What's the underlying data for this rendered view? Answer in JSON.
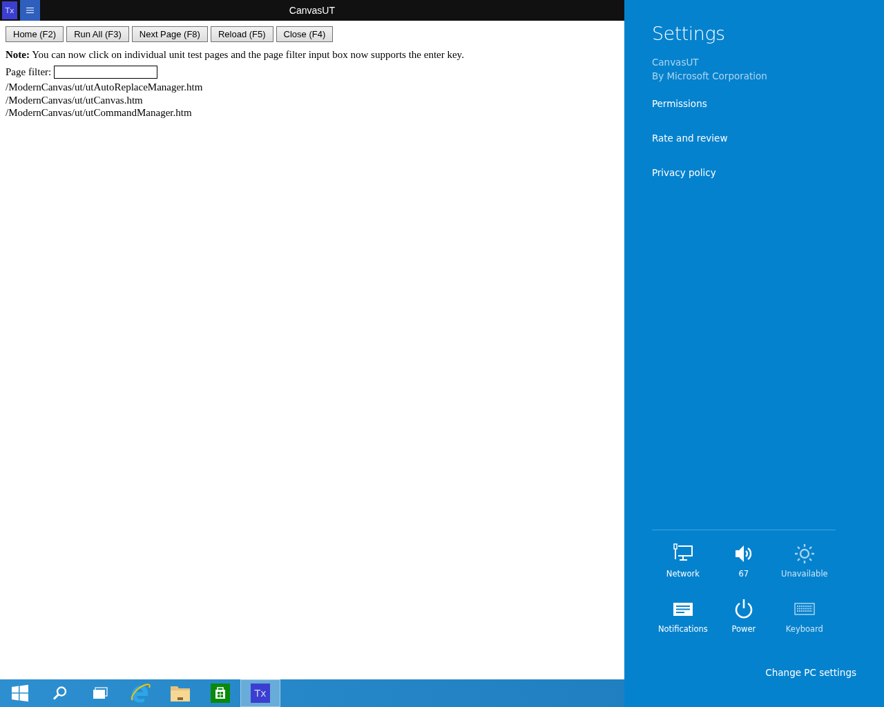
{
  "window": {
    "app_tile": "Tx",
    "title": "CanvasUT"
  },
  "toolbar": {
    "buttons": [
      "Home (F2)",
      "Run All (F3)",
      "Next Page (F8)",
      "Reload (F5)",
      "Close (F4)"
    ]
  },
  "note": "**Note:** You can now click on individual unit test pages and the page filter input box now supports the enter key.",
  "filter": {
    "label": "Page filter:"
  },
  "pages": [
    "/ModernCanvas/ut/utAutoReplaceManager.htm",
    "/ModernCanvas/ut/utCanvas.htm",
    "/ModernCanvas/ut/utCommandManager.htm"
  ],
  "settings_pane": {
    "title": "Settings",
    "app_name": "CanvasUT",
    "publisher": "By Microsoft Corporation",
    "links": [
      "Permissions",
      "Rate and review",
      "Privacy policy"
    ],
    "quick_actions": [
      {
        "kind": "network",
        "label": "Network",
        "disabled": false
      },
      {
        "kind": "volume",
        "label": "67",
        "disabled": false
      },
      {
        "kind": "brightness",
        "label": "Unavailable",
        "disabled": true
      },
      {
        "kind": "notifications",
        "label": "Notifications",
        "disabled": false
      },
      {
        "kind": "power",
        "label": "Power",
        "disabled": false
      },
      {
        "kind": "keyboard",
        "label": "Keyboard",
        "disabled": true
      }
    ],
    "footer_link": "Change PC settings"
  },
  "taskbar": {
    "items": [
      {
        "kind": "start",
        "selected": false
      },
      {
        "kind": "search",
        "selected": false
      },
      {
        "kind": "task-view",
        "selected": false
      },
      {
        "kind": "browser",
        "selected": false
      },
      {
        "kind": "files",
        "selected": false
      },
      {
        "kind": "store",
        "selected": false
      },
      {
        "kind": "app",
        "label": "Tx",
        "selected": true
      }
    ]
  }
}
